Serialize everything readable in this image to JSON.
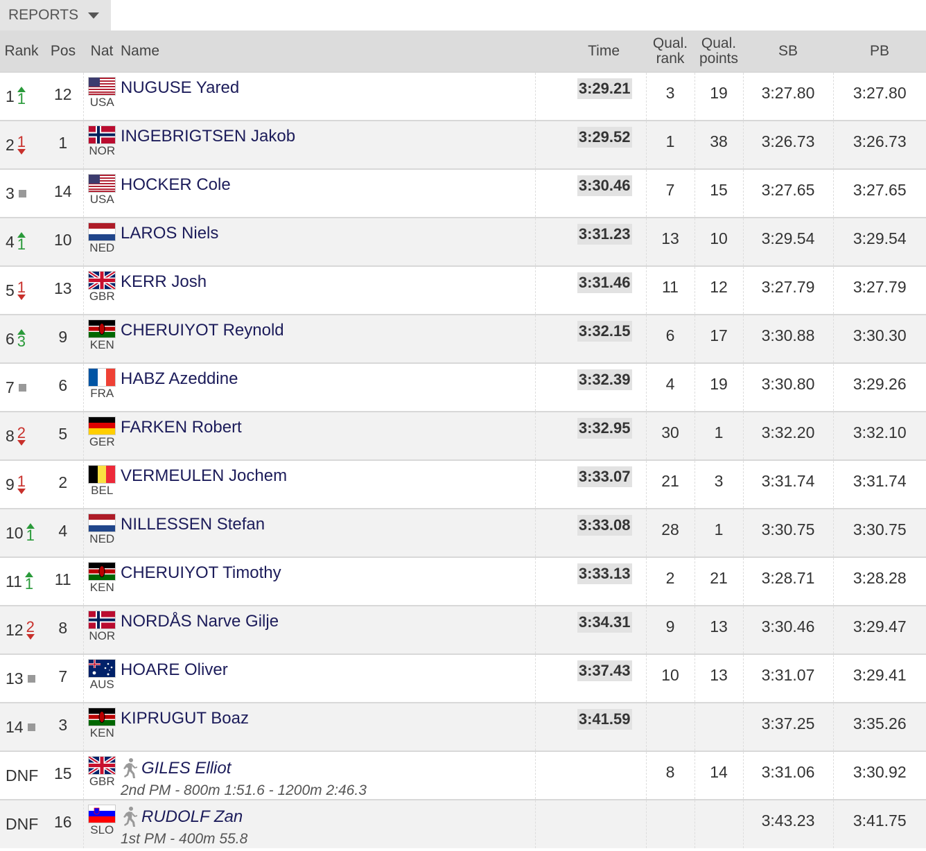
{
  "reports_label": "REPORTS",
  "headers": {
    "rank": "Rank",
    "pos": "Pos",
    "nat": "Nat",
    "name": "Name",
    "time": "Time",
    "qual_rank": [
      "Qual.",
      "rank"
    ],
    "qual_points": [
      "Qual.",
      "points"
    ],
    "sb": "SB",
    "pb": "PB"
  },
  "rows": [
    {
      "rank": "1",
      "move": "up",
      "move_n": "1",
      "pos": "12",
      "nat": "USA",
      "name": "NUGUSE Yared",
      "time": "3:29.21",
      "qr": "3",
      "qp": "19",
      "sb": "3:27.80",
      "pb": "3:27.80"
    },
    {
      "rank": "2",
      "move": "down",
      "move_n": "1",
      "pos": "1",
      "nat": "NOR",
      "name": "INGEBRIGTSEN Jakob",
      "time": "3:29.52",
      "qr": "1",
      "qp": "38",
      "sb": "3:26.73",
      "pb": "3:26.73"
    },
    {
      "rank": "3",
      "move": "same",
      "move_n": "",
      "pos": "14",
      "nat": "USA",
      "name": "HOCKER Cole",
      "time": "3:30.46",
      "qr": "7",
      "qp": "15",
      "sb": "3:27.65",
      "pb": "3:27.65"
    },
    {
      "rank": "4",
      "move": "up",
      "move_n": "1",
      "pos": "10",
      "nat": "NED",
      "name": "LAROS Niels",
      "time": "3:31.23",
      "qr": "13",
      "qp": "10",
      "sb": "3:29.54",
      "pb": "3:29.54"
    },
    {
      "rank": "5",
      "move": "down",
      "move_n": "1",
      "pos": "13",
      "nat": "GBR",
      "name": "KERR Josh",
      "time": "3:31.46",
      "qr": "11",
      "qp": "12",
      "sb": "3:27.79",
      "pb": "3:27.79"
    },
    {
      "rank": "6",
      "move": "up",
      "move_n": "3",
      "pos": "9",
      "nat": "KEN",
      "name": "CHERUIYOT Reynold",
      "time": "3:32.15",
      "qr": "6",
      "qp": "17",
      "sb": "3:30.88",
      "pb": "3:30.30"
    },
    {
      "rank": "7",
      "move": "same",
      "move_n": "",
      "pos": "6",
      "nat": "FRA",
      "name": "HABZ Azeddine",
      "time": "3:32.39",
      "qr": "4",
      "qp": "19",
      "sb": "3:30.80",
      "pb": "3:29.26"
    },
    {
      "rank": "8",
      "move": "down",
      "move_n": "2",
      "pos": "5",
      "nat": "GER",
      "name": "FARKEN Robert",
      "time": "3:32.95",
      "qr": "30",
      "qp": "1",
      "sb": "3:32.20",
      "pb": "3:32.10"
    },
    {
      "rank": "9",
      "move": "down",
      "move_n": "1",
      "pos": "2",
      "nat": "BEL",
      "name": "VERMEULEN Jochem",
      "time": "3:33.07",
      "qr": "21",
      "qp": "3",
      "sb": "3:31.74",
      "pb": "3:31.74"
    },
    {
      "rank": "10",
      "move": "up",
      "move_n": "1",
      "pos": "4",
      "nat": "NED",
      "name": "NILLESSEN Stefan",
      "time": "3:33.08",
      "qr": "28",
      "qp": "1",
      "sb": "3:30.75",
      "pb": "3:30.75"
    },
    {
      "rank": "11",
      "move": "up",
      "move_n": "1",
      "pos": "11",
      "nat": "KEN",
      "name": "CHERUIYOT Timothy",
      "time": "3:33.13",
      "qr": "2",
      "qp": "21",
      "sb": "3:28.71",
      "pb": "3:28.28"
    },
    {
      "rank": "12",
      "move": "down",
      "move_n": "2",
      "pos": "8",
      "nat": "NOR",
      "name": "NORDÅS Narve Gilje",
      "time": "3:34.31",
      "qr": "9",
      "qp": "13",
      "sb": "3:30.46",
      "pb": "3:29.47"
    },
    {
      "rank": "13",
      "move": "same",
      "move_n": "",
      "pos": "7",
      "nat": "AUS",
      "name": "HOARE Oliver",
      "time": "3:37.43",
      "qr": "10",
      "qp": "13",
      "sb": "3:31.07",
      "pb": "3:29.41"
    },
    {
      "rank": "14",
      "move": "same",
      "move_n": "",
      "pos": "3",
      "nat": "KEN",
      "name": "KIPRUGUT Boaz",
      "time": "3:41.59",
      "qr": "",
      "qp": "",
      "sb": "3:37.25",
      "pb": "3:35.26"
    },
    {
      "rank": "DNF",
      "move": "none",
      "move_n": "",
      "pos": "15",
      "nat": "GBR",
      "name": "GILES Elliot",
      "dnf": true,
      "detail": "2nd PM - 800m 1:51.6 - 1200m 2:46.3",
      "time": "",
      "qr": "8",
      "qp": "14",
      "sb": "3:31.06",
      "pb": "3:30.92"
    },
    {
      "rank": "DNF",
      "move": "none",
      "move_n": "",
      "pos": "16",
      "nat": "SLO",
      "name": "RUDOLF Zan",
      "dnf": true,
      "detail": "1st PM - 400m 55.8",
      "time": "",
      "qr": "",
      "qp": "",
      "sb": "3:43.23",
      "pb": "3:41.75"
    }
  ],
  "colors": {
    "up": "#2a9a3a",
    "down": "#c8302b",
    "name": "#1c1c5a",
    "header_bg": "#dcdcdc"
  }
}
